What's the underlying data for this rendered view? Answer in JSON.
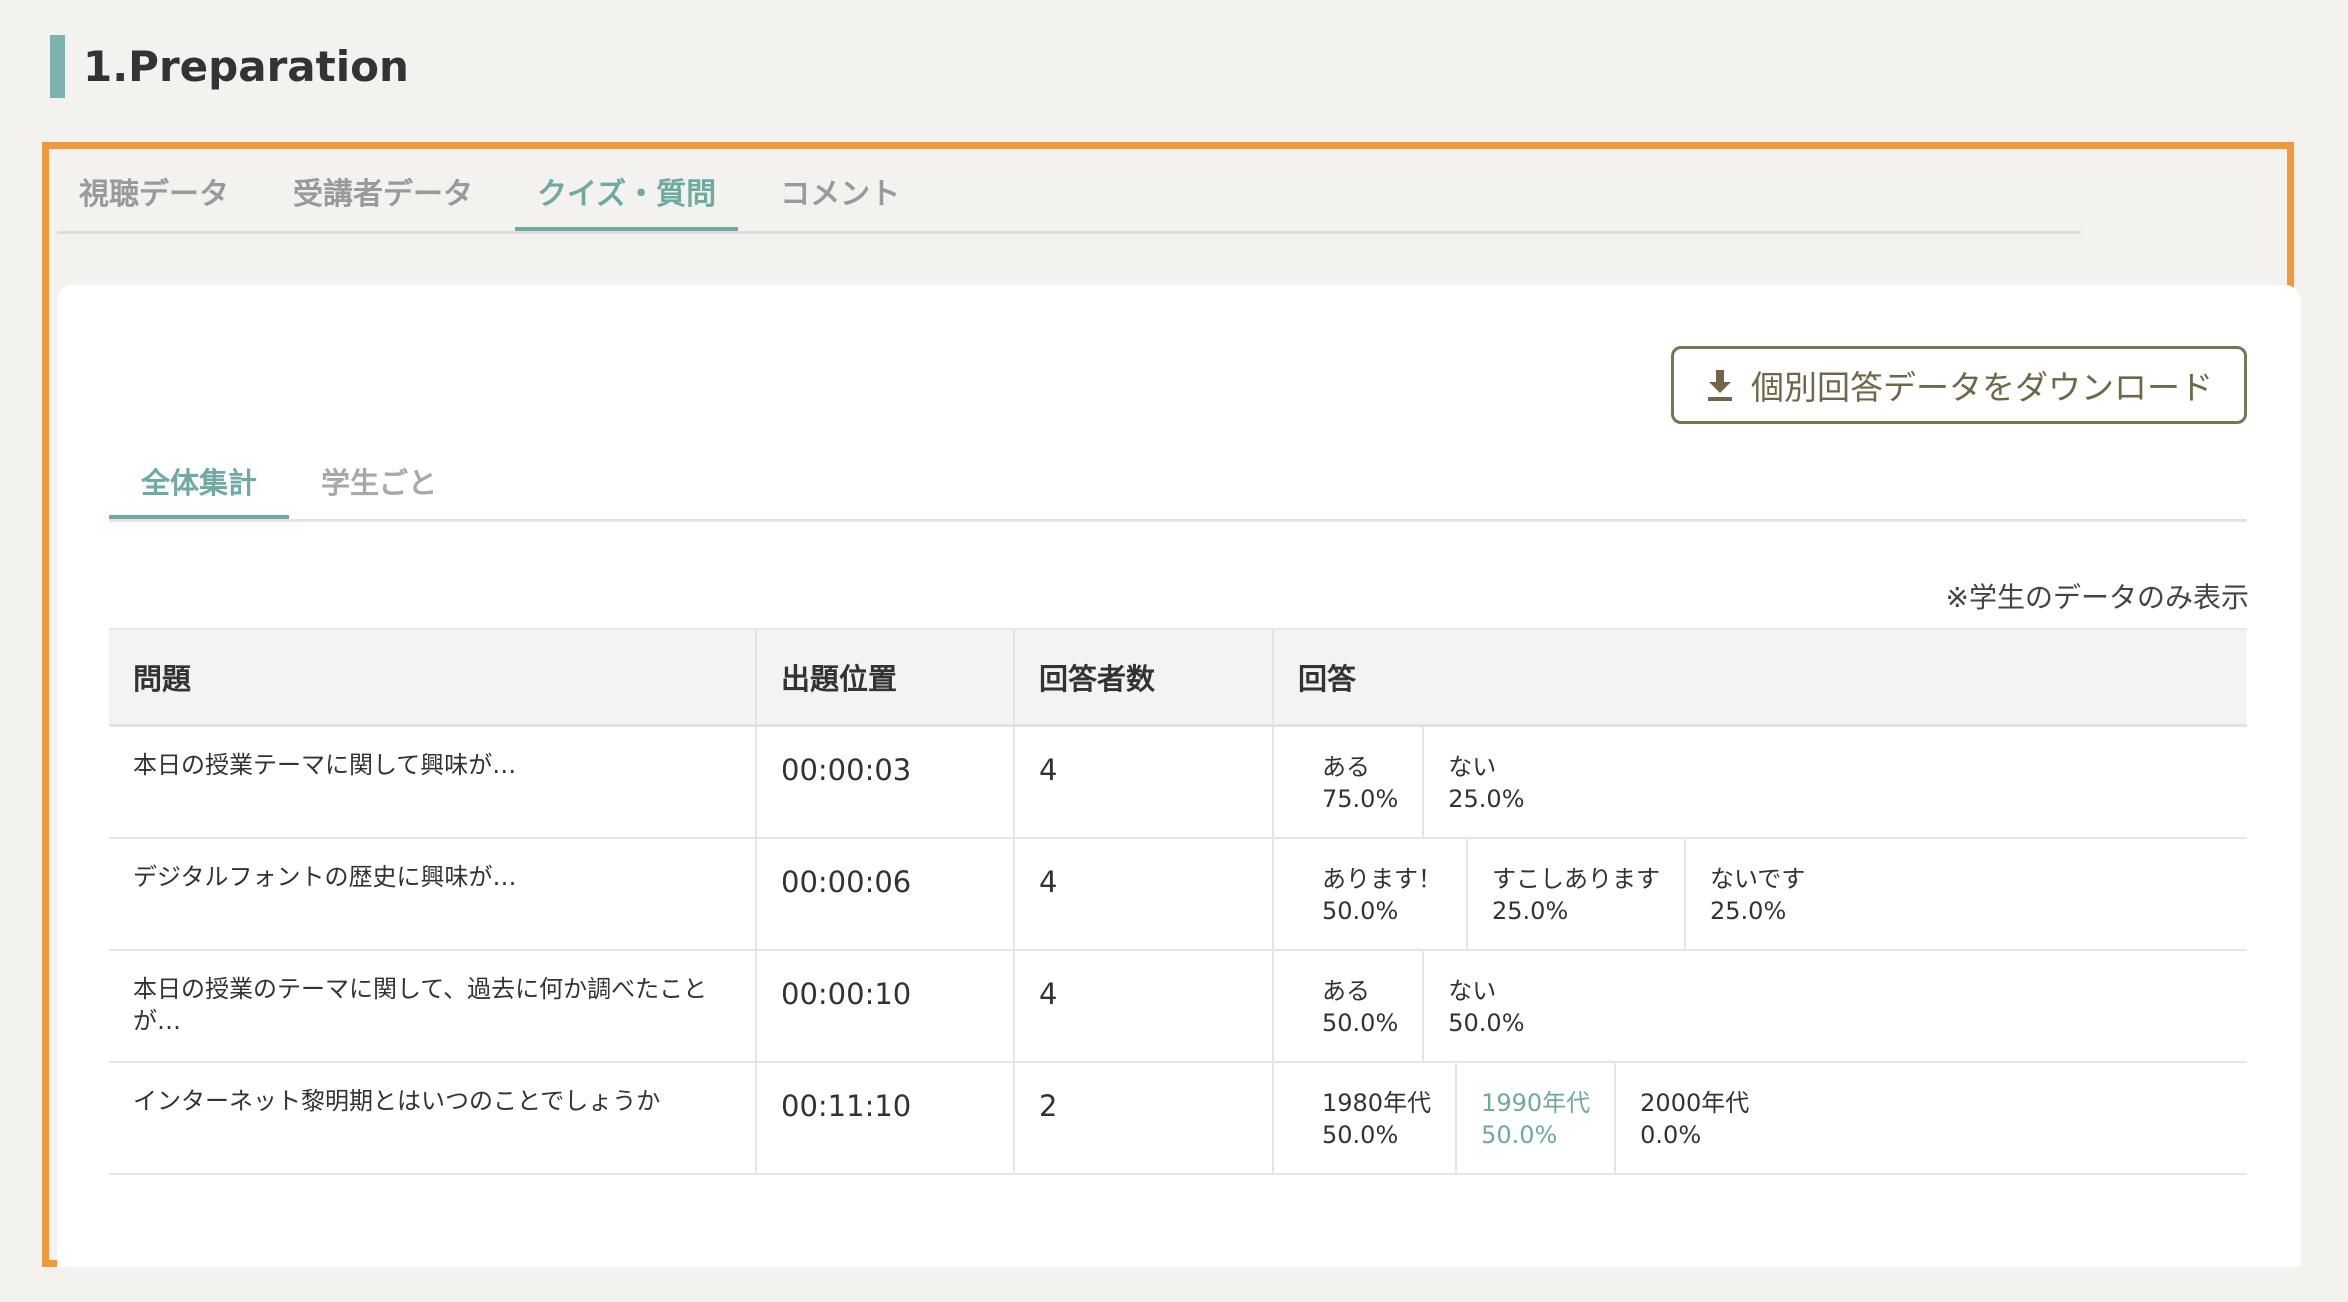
{
  "section_title": "1.Preparation",
  "main_tabs": [
    {
      "label": "視聴データ"
    },
    {
      "label": "受講者データ"
    },
    {
      "label": "クイズ・質問"
    },
    {
      "label": "コメント"
    }
  ],
  "download_button": {
    "label": "個別回答データをダウンロード",
    "icon": "download-icon"
  },
  "sub_tabs": [
    {
      "label": "全体集計"
    },
    {
      "label": "学生ごと"
    }
  ],
  "note": "※学生のデータのみ表示",
  "table": {
    "headers": [
      "問題",
      "出題位置",
      "回答者数",
      "回答"
    ],
    "rows": [
      {
        "question": "本日の授業テーマに関して興味が…",
        "position": "00:00:03",
        "respondents": "4",
        "answers": [
          {
            "label": "ある",
            "pct": "75.0%"
          },
          {
            "label": "ない",
            "pct": "25.0%"
          }
        ]
      },
      {
        "question": "デジタルフォントの歴史に興味が…",
        "position": "00:00:06",
        "respondents": "4",
        "answers": [
          {
            "label": "あります！",
            "pct": "50.0%"
          },
          {
            "label": "すこしあります",
            "pct": "25.0%"
          },
          {
            "label": "ないです",
            "pct": "25.0%"
          }
        ]
      },
      {
        "question": "本日の授業のテーマに関して、過去に何か調べたことが…",
        "position": "00:00:10",
        "respondents": "4",
        "answers": [
          {
            "label": "ある",
            "pct": "50.0%"
          },
          {
            "label": "ない",
            "pct": "50.0%"
          }
        ]
      },
      {
        "question": "インターネット黎明期とはいつのことでしょうか",
        "position": "00:11:10",
        "respondents": "2",
        "answers": [
          {
            "label": "1980年代",
            "pct": "50.0%"
          },
          {
            "label": "1990年代",
            "pct": "50.0%"
          },
          {
            "label": "2000年代",
            "pct": "0.0%"
          }
        ]
      }
    ]
  },
  "colors": {
    "accent": "#6ea9a2",
    "highlight_border": "#f0983c",
    "button_border": "#7b7356",
    "background": "#f3f2ef"
  }
}
